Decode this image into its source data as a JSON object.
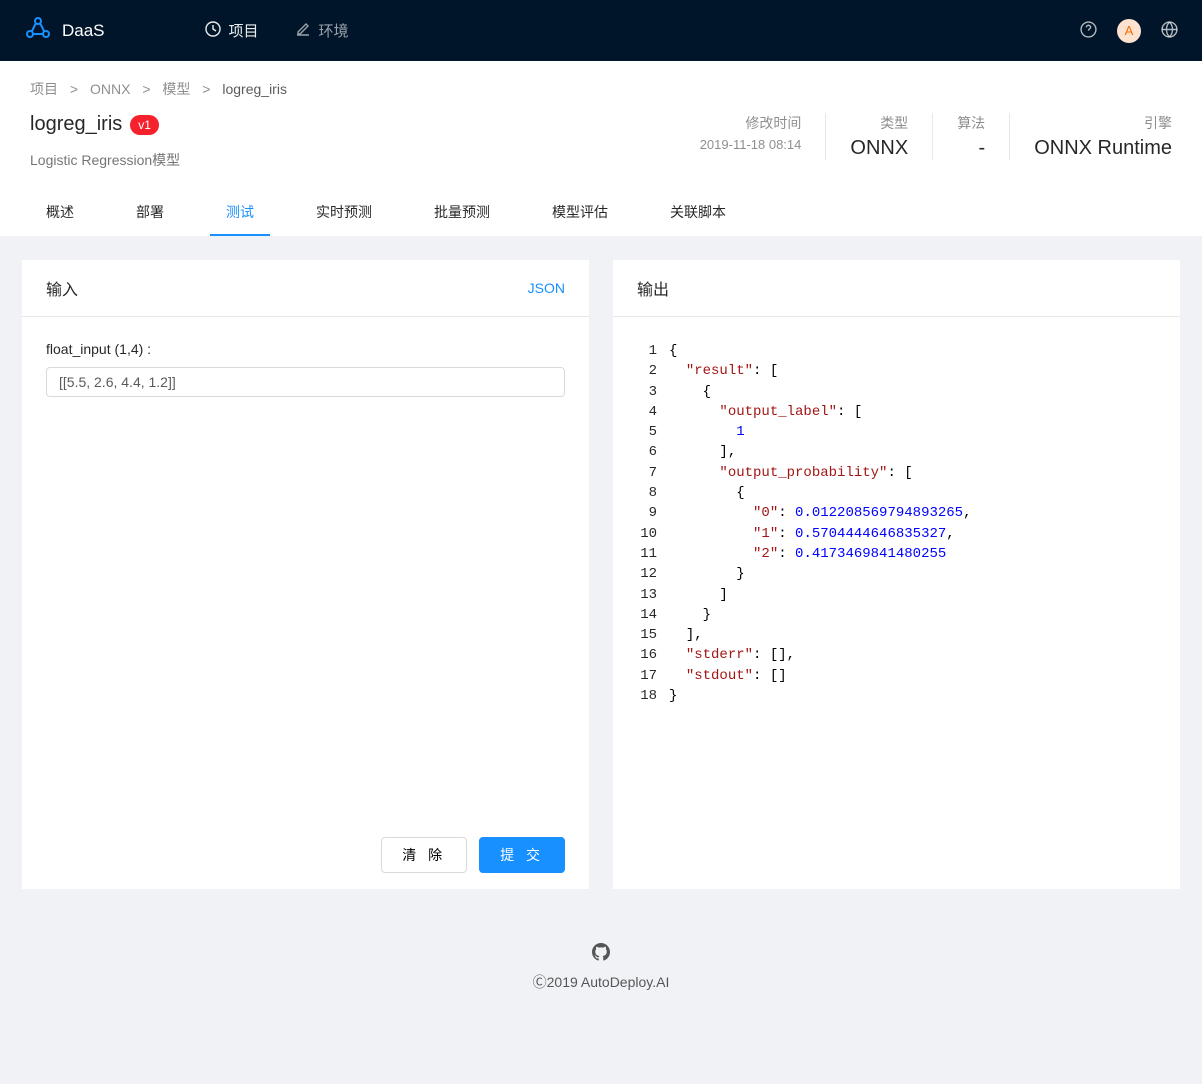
{
  "header": {
    "brand": "DaaS",
    "nav": {
      "projects": "项目",
      "env": "环境"
    },
    "avatar_initial": "A"
  },
  "breadcrumb": {
    "items": [
      "项目",
      "ONNX",
      "模型"
    ],
    "current": "logreg_iris"
  },
  "page": {
    "title": "logreg_iris",
    "version": "v1",
    "subtitle": "Logistic Regression模型"
  },
  "meta": {
    "modified_label": "修改时间",
    "modified_value": "2019-11-18 08:14",
    "type_label": "类型",
    "type_value": "ONNX",
    "algo_label": "算法",
    "algo_value": "-",
    "engine_label": "引擎",
    "engine_value": "ONNX Runtime"
  },
  "tabs": {
    "overview": "概述",
    "deploy": "部署",
    "test": "测试",
    "realtime": "实时预测",
    "batch": "批量预测",
    "eval": "模型评估",
    "scripts": "关联脚本"
  },
  "input_panel": {
    "title": "输入",
    "format": "JSON",
    "field_label": "float_input (1,4) :",
    "field_value": "[[5.5, 2.6, 4.4, 1.2]]",
    "clear_btn": "清 除",
    "submit_btn": "提 交"
  },
  "output_panel": {
    "title": "输出",
    "code_lines": [
      {
        "n": 1,
        "tokens": [
          {
            "t": "punct",
            "v": "{"
          }
        ]
      },
      {
        "n": 2,
        "tokens": [
          {
            "t": "ws",
            "v": "  "
          },
          {
            "t": "key",
            "v": "\"result\""
          },
          {
            "t": "punct",
            "v": ": ["
          }
        ]
      },
      {
        "n": 3,
        "tokens": [
          {
            "t": "ws",
            "v": "    "
          },
          {
            "t": "punct",
            "v": "{"
          }
        ]
      },
      {
        "n": 4,
        "tokens": [
          {
            "t": "ws",
            "v": "      "
          },
          {
            "t": "key",
            "v": "\"output_label\""
          },
          {
            "t": "punct",
            "v": ": ["
          }
        ]
      },
      {
        "n": 5,
        "tokens": [
          {
            "t": "ws",
            "v": "        "
          },
          {
            "t": "num",
            "v": "1"
          }
        ]
      },
      {
        "n": 6,
        "tokens": [
          {
            "t": "ws",
            "v": "      "
          },
          {
            "t": "punct",
            "v": "],"
          }
        ]
      },
      {
        "n": 7,
        "tokens": [
          {
            "t": "ws",
            "v": "      "
          },
          {
            "t": "key",
            "v": "\"output_probability\""
          },
          {
            "t": "punct",
            "v": ": ["
          }
        ]
      },
      {
        "n": 8,
        "tokens": [
          {
            "t": "ws",
            "v": "        "
          },
          {
            "t": "punct",
            "v": "{"
          }
        ]
      },
      {
        "n": 9,
        "tokens": [
          {
            "t": "ws",
            "v": "          "
          },
          {
            "t": "key",
            "v": "\"0\""
          },
          {
            "t": "punct",
            "v": ": "
          },
          {
            "t": "num",
            "v": "0.012208569794893265"
          },
          {
            "t": "punct",
            "v": ","
          }
        ]
      },
      {
        "n": 10,
        "tokens": [
          {
            "t": "ws",
            "v": "          "
          },
          {
            "t": "key",
            "v": "\"1\""
          },
          {
            "t": "punct",
            "v": ": "
          },
          {
            "t": "num",
            "v": "0.5704444646835327"
          },
          {
            "t": "punct",
            "v": ","
          }
        ]
      },
      {
        "n": 11,
        "tokens": [
          {
            "t": "ws",
            "v": "          "
          },
          {
            "t": "key",
            "v": "\"2\""
          },
          {
            "t": "punct",
            "v": ": "
          },
          {
            "t": "num",
            "v": "0.4173469841480255"
          }
        ]
      },
      {
        "n": 12,
        "tokens": [
          {
            "t": "ws",
            "v": "        "
          },
          {
            "t": "punct",
            "v": "}"
          }
        ]
      },
      {
        "n": 13,
        "tokens": [
          {
            "t": "ws",
            "v": "      "
          },
          {
            "t": "punct",
            "v": "]"
          }
        ]
      },
      {
        "n": 14,
        "tokens": [
          {
            "t": "ws",
            "v": "    "
          },
          {
            "t": "punct",
            "v": "}"
          }
        ]
      },
      {
        "n": 15,
        "tokens": [
          {
            "t": "ws",
            "v": "  "
          },
          {
            "t": "punct",
            "v": "],"
          }
        ]
      },
      {
        "n": 16,
        "tokens": [
          {
            "t": "ws",
            "v": "  "
          },
          {
            "t": "key",
            "v": "\"stderr\""
          },
          {
            "t": "punct",
            "v": ": [],"
          }
        ]
      },
      {
        "n": 17,
        "tokens": [
          {
            "t": "ws",
            "v": "  "
          },
          {
            "t": "key",
            "v": "\"stdout\""
          },
          {
            "t": "punct",
            "v": ": []"
          }
        ]
      },
      {
        "n": 18,
        "tokens": [
          {
            "t": "punct",
            "v": "}"
          }
        ]
      }
    ]
  },
  "footer": {
    "copyright": "Ⓒ2019 AutoDeploy.AI"
  }
}
